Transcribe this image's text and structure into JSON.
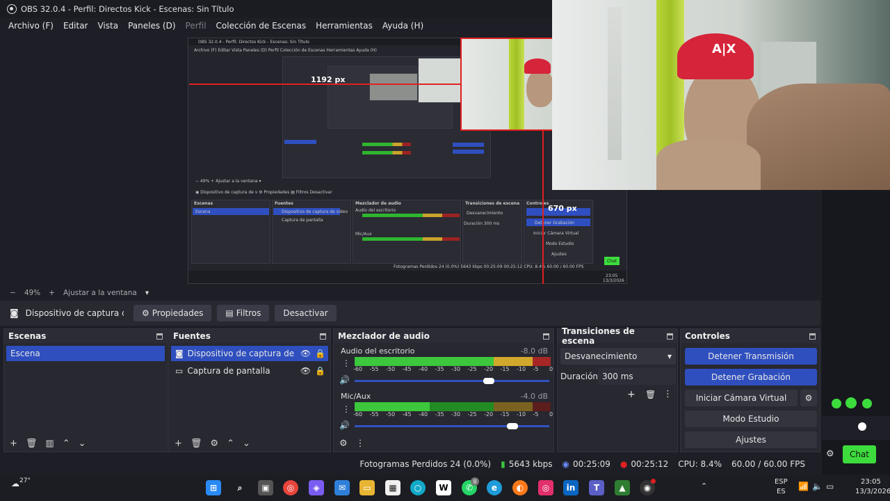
{
  "window": {
    "title": "OBS 32.0.4 - Perfil: Directos Kick - Escenas: Sin Título"
  },
  "menu": {
    "items": [
      "Archivo (F)",
      "Editar",
      "Vista",
      "Paneles (D)",
      "Perfil",
      "Colección de Escenas",
      "Herramientas",
      "Ayuda (H)"
    ]
  },
  "preview": {
    "measure_width": "1192 px",
    "measure_height": "670 px",
    "nested_chat_label": "Chat"
  },
  "zoom": {
    "minus": "−",
    "percent": "49%",
    "plus": "+",
    "fit_label": "Ajustar a la ventana"
  },
  "source_toolbar": {
    "source_name": "Dispositivo de captura de v",
    "properties_label": "Propiedades",
    "filters_label": "Filtros",
    "deactivate_label": "Desactivar"
  },
  "scenes": {
    "title": "Escenas",
    "items": [
      "Escena"
    ]
  },
  "sources": {
    "title": "Fuentes",
    "items": [
      "Dispositivo de captura de video",
      "Captura de pantalla"
    ]
  },
  "mixer": {
    "title": "Mezclador de audio",
    "channels": [
      {
        "name": "Audio del escritorio",
        "db": "-8.0 dB",
        "volume": 0.69
      },
      {
        "name": "Mic/Aux",
        "db": "-4.0 dB",
        "volume": 0.81
      }
    ],
    "ticks": [
      "-60",
      "-55",
      "-50",
      "-45",
      "-40",
      "-35",
      "-30",
      "-25",
      "-20",
      "-15",
      "-10",
      "-5",
      "0"
    ]
  },
  "transitions": {
    "title": "Transiciones de escena",
    "selected": "Desvanecimiento",
    "duration_label": "Duración",
    "duration_value": "300 ms"
  },
  "controls": {
    "title": "Controles",
    "stop_stream": "Detener Transmisión",
    "stop_record": "Detener Grabación",
    "virtual_cam": "Iniciar Cámara Virtual",
    "studio_mode": "Modo Estudio",
    "settings": "Ajustes"
  },
  "status": {
    "dropped_frames": "Fotogramas Perdidos 24 (0.0%)",
    "bitrate": "5643 kbps",
    "stream_time": "00:25:09",
    "record_time": "00:25:12",
    "cpu": "CPU: 8.4%",
    "fps": "60.00 / 60.00 FPS"
  },
  "chat": {
    "button_label": "Chat"
  },
  "taskbar": {
    "weather": "27°",
    "language": "ESP",
    "language_sub": "ES",
    "time": "23:05",
    "date": "13/3/2026",
    "whatsapp_badge": "8"
  },
  "colors": {
    "accent_blue": "#2f4fbf",
    "meter_green": "#3cc73c",
    "meter_yellow": "#d1a82b",
    "meter_red": "#a72626",
    "chat_green": "#3ddc3d"
  }
}
